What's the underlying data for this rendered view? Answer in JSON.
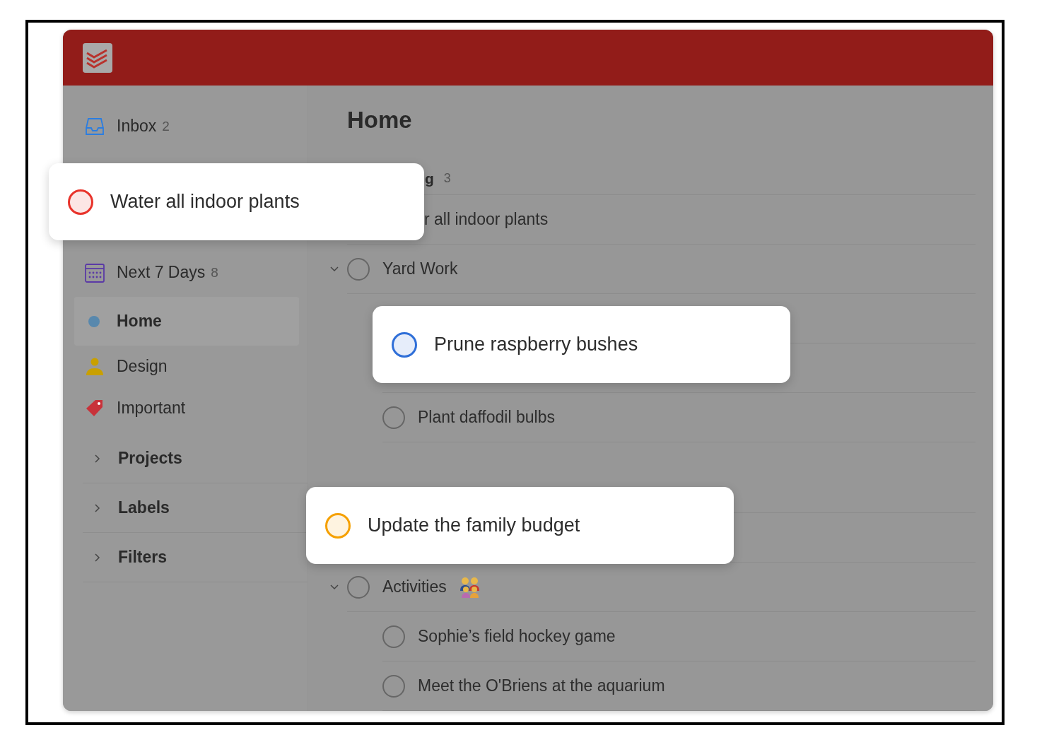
{
  "sidebar": {
    "items": [
      {
        "kind": "inbox",
        "label": "Inbox",
        "count": "2",
        "selected": false
      },
      {
        "kind": "calendar",
        "label": "Next 7 Days",
        "count": "8",
        "selected": false
      },
      {
        "kind": "dot",
        "label": "Home",
        "selected": true
      },
      {
        "kind": "person",
        "label": "Design",
        "selected": false
      },
      {
        "kind": "tag",
        "label": "Important",
        "selected": false
      }
    ],
    "groups": [
      {
        "label": "Projects",
        "expanded": false
      },
      {
        "label": "Labels",
        "expanded": false
      },
      {
        "label": "Filters",
        "expanded": false
      }
    ]
  },
  "main": {
    "title": "Home",
    "section": {
      "title": "g",
      "count": "3"
    },
    "rows": [
      {
        "kind": "clipped",
        "text": "r all indoor plants"
      },
      {
        "kind": "parent",
        "text": "Yard Work",
        "checked": false,
        "expanded": true,
        "children": [
          {
            "kind": "covered"
          },
          {
            "kind": "covered"
          },
          {
            "kind": "task",
            "text": "Plant daffodil bulbs",
            "checked": false
          }
        ]
      },
      {
        "kind": "covered-header"
      },
      {
        "kind": "covered"
      },
      {
        "kind": "family-parent",
        "text": "Activities",
        "checked": false,
        "expanded": true,
        "children": [
          {
            "kind": "task",
            "text": "Sophie’s field hockey game",
            "checked": false
          },
          {
            "kind": "task",
            "text": "Meet the O'Briens at the aquarium",
            "checked": false
          }
        ]
      }
    ]
  },
  "cards": [
    {
      "text": "Water all indoor plants",
      "color": "#e8332b"
    },
    {
      "text": "Prune raspberry bushes",
      "color": "#2f6fd8"
    },
    {
      "text": "Update the family budget",
      "color": "#f5a000"
    }
  ]
}
